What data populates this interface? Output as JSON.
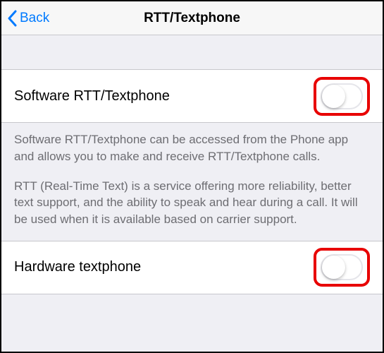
{
  "navbar": {
    "back_label": "Back",
    "title": "RTT/Textphone"
  },
  "rows": {
    "software": {
      "label": "Software RTT/Textphone",
      "enabled": false
    },
    "hardware": {
      "label": "Hardware textphone",
      "enabled": false
    }
  },
  "footer": {
    "p1": "Software RTT/Textphone can be accessed from the Phone app and allows you to make and receive RTT/Textphone calls.",
    "p2": "RTT (Real-Time Text) is a service offering more reliability, better text support, and the ability to speak and hear during a call. It will be used when it is available based on carrier support."
  }
}
